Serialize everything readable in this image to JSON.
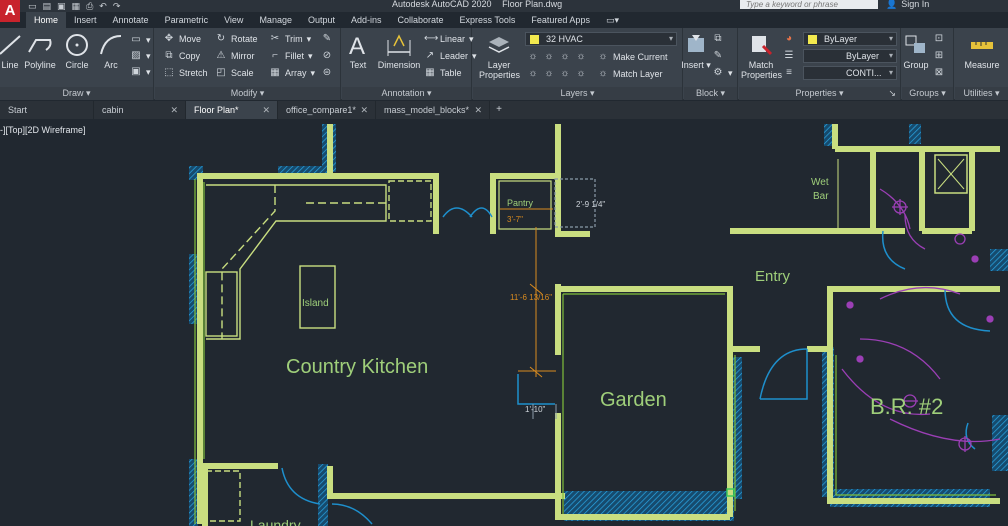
{
  "app": {
    "title_app": "Autodesk AutoCAD 2020",
    "title_file": "Floor Plan.dwg",
    "logo_letter": "A",
    "search_placeholder": "Type a keyword or phrase",
    "sign_in": "Sign In"
  },
  "ribbon_tabs": [
    "Home",
    "Insert",
    "Annotate",
    "Parametric",
    "View",
    "Manage",
    "Output",
    "Add-ins",
    "Collaborate",
    "Express Tools",
    "Featured Apps"
  ],
  "draw": {
    "title": "Draw",
    "line": "Line",
    "polyline": "Polyline",
    "circle": "Circle",
    "arc": "Arc"
  },
  "modify": {
    "title": "Modify",
    "move": "Move",
    "rotate": "Rotate",
    "trim": "Trim",
    "copy": "Copy",
    "mirror": "Mirror",
    "fillet": "Fillet",
    "stretch": "Stretch",
    "scale": "Scale",
    "array": "Array"
  },
  "annotation": {
    "title": "Annotation",
    "text": "Text",
    "dimension": "Dimension",
    "linear": "Linear",
    "leader": "Leader",
    "table": "Table"
  },
  "layers": {
    "title": "Layers",
    "layer_properties_1": "Layer",
    "layer_properties_2": "Properties",
    "current_layer": "32 HVAC",
    "make_current": "Make Current",
    "match_layer": "Match Layer"
  },
  "block": {
    "title": "Block",
    "insert": "Insert"
  },
  "properties": {
    "title": "Properties",
    "match_1": "Match",
    "match_2": "Properties",
    "color": "ByLayer",
    "linetype": "ByLayer",
    "lineweight": "CONTI..."
  },
  "groups": {
    "title": "Groups",
    "group": "Group"
  },
  "utilities": {
    "title": "Utilities",
    "measure": "Measure"
  },
  "file_tabs": [
    {
      "label": "Start"
    },
    {
      "label": "cabin elevation"
    },
    {
      "label": "Floor Plan*"
    },
    {
      "label": "office_compare1*"
    },
    {
      "label": "mass_model_blocks*"
    }
  ],
  "viewport": {
    "label": "-][Top][2D Wireframe]"
  },
  "drawing": {
    "room_kitchen": "Country Kitchen",
    "room_island": "Island",
    "room_pantry": "Pantry",
    "room_garden": "Garden",
    "room_entry": "Entry",
    "room_wet": "Wet",
    "room_bar": "Bar",
    "room_br2": "B.R. #2",
    "room_laundry": "Laundry",
    "dim_pantry_w": "3'-7\"",
    "dim_pantry_side": "2'-9 1/4\"",
    "dim_vertical": "11'-6 13/16\"",
    "dim_door": "1'-10\""
  },
  "colors": {
    "wall": "#c9de80",
    "hatch": "#1e8fcc",
    "dim": "#d98b1f",
    "text": "#9fcf7a",
    "electrical": "#9b3fb5"
  }
}
